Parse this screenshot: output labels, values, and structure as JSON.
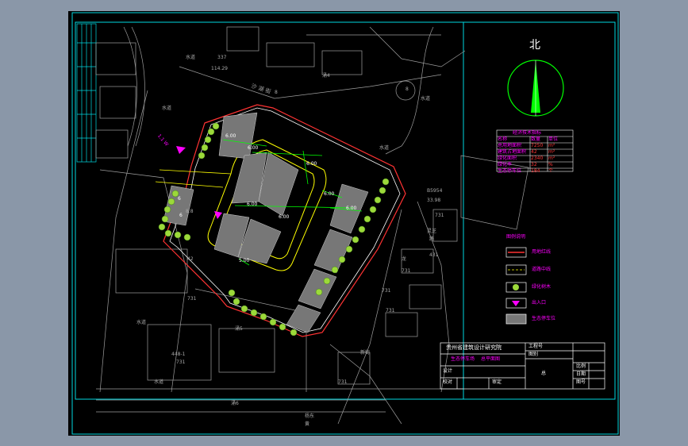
{
  "colors": {
    "background": "#8a97a8",
    "canvas": "#000000",
    "frame": "#00d7e0",
    "linework": "#9e9e9e",
    "road": "#ffff00",
    "greenery": "#9cd93a",
    "dimension": "#00ff00",
    "magenta": "#ff00ff",
    "red_line": "#ff3333"
  },
  "compass": {
    "label": "北"
  },
  "map_labels": {
    "street_top": "涌4",
    "water_1": "水道",
    "water_2": "水道",
    "water_3": "水道",
    "water_4": "水道",
    "water_5": "水道",
    "water_6": "水道",
    "road_name": "沙 湖 街",
    "elev_1": "337",
    "elev_2": "114.29",
    "marker_a": "8",
    "marker_b": "8",
    "street_5": "涌5",
    "street_6": "涌6",
    "bottom_a": "杨东",
    "bottom_b": "黄",
    "right_num": "B5954",
    "right_num2": "33.98",
    "label_a": "灵芝",
    "label_b": "路",
    "label_c": "新街",
    "label_d": "龙",
    "label_e": "431",
    "plot_1": "1.1 W",
    "plot_2": "8.8",
    "plot_3": "42",
    "n_1": "731",
    "n_2": "731",
    "n_3": "731",
    "n_4": "731",
    "n_5": "731",
    "n_6": "448-1",
    "n_7": "731",
    "n_8": "731"
  },
  "dims": {
    "d1": "6.00",
    "d2": "6.00",
    "d3": "6.00",
    "d4": "6.00",
    "d5": "6.00",
    "d6": "6.00",
    "d7": "6.00",
    "d8": "5.00",
    "d9": "6",
    "d10": "6"
  },
  "stats_table": {
    "title": "经济技术指标",
    "head": [
      "名称",
      "数量",
      "单位"
    ],
    "rows": [
      [
        "总用地面积",
        "7250",
        "m²"
      ],
      [
        "建筑占地面积",
        "42",
        "m²"
      ],
      [
        "绿化面积",
        "2340",
        "m²"
      ],
      [
        "绿化率",
        "32",
        "%"
      ],
      [
        "生态停车位",
        "184",
        "个"
      ]
    ]
  },
  "legend": {
    "title": "图例说明",
    "items": [
      "用地红线",
      "道路中线",
      "绿化树木",
      "出入口",
      "生态停车位"
    ]
  },
  "title_block": {
    "company": "贵州省建筑设计研究院",
    "project": "生态停车场",
    "drawing": "总平面图",
    "design": "设计",
    "check": "校对",
    "approve": "审定",
    "scale": "比例",
    "date": "日期",
    "sheet": "图号",
    "stamp": "总",
    "cell_r1": "工程号",
    "cell_r2": "图别"
  }
}
